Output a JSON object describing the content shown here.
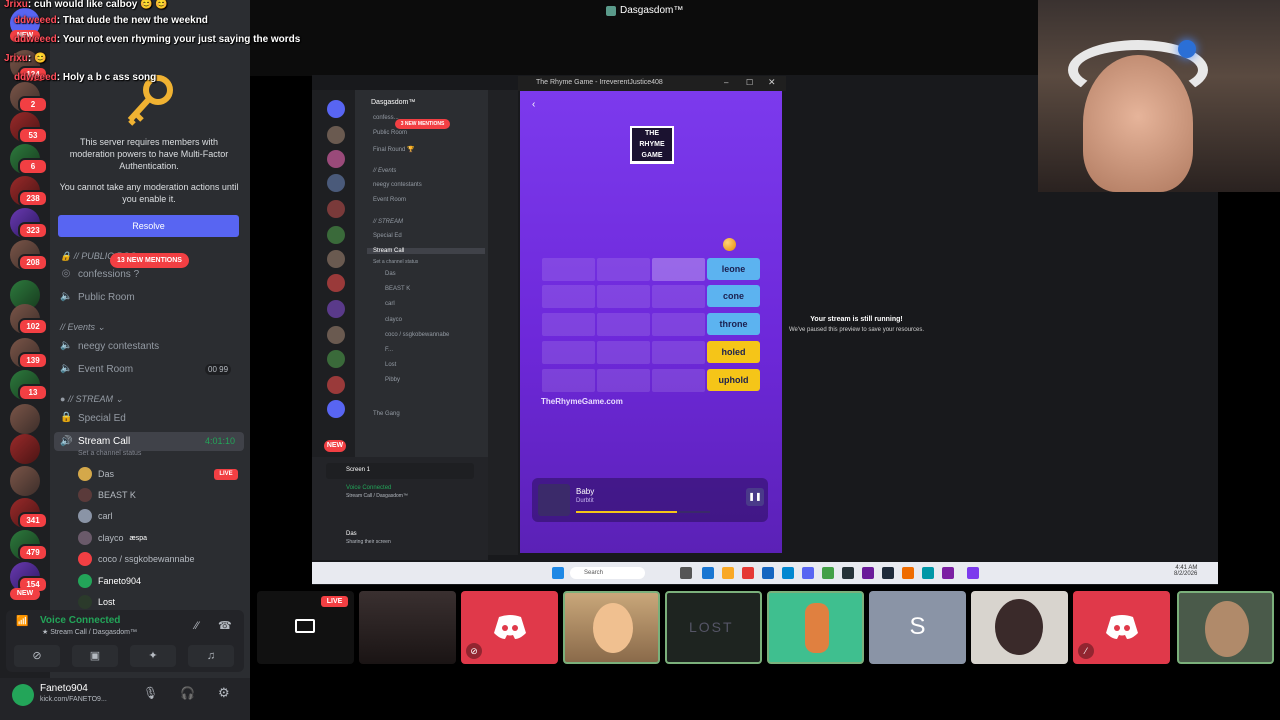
{
  "window": {
    "title": "Dasgasdom™"
  },
  "chat": [
    {
      "user": "Jrixu",
      "text": ": cuh would like calboy 😊 😊"
    },
    {
      "user": "ddweeed",
      "text": ": That dude the new the weeknd"
    },
    {
      "user": "ddweeed",
      "text": ": Your not even rhyming your just saying the words"
    },
    {
      "user": "Jrixu",
      "text": ": 😊"
    },
    {
      "user": "ddweeed",
      "text": ": Holy a b c ass song"
    }
  ],
  "rail": {
    "new_label": "NEW",
    "badges": [
      "124",
      "2",
      "53",
      "6",
      "238",
      "323",
      "208",
      "102",
      "139",
      "13",
      "341",
      "479",
      "154"
    ],
    "bottom_new": "NEW"
  },
  "server": {
    "name": "Dasgasdom™",
    "mfa_text": "This server requires members with moderation powers to have Multi-Factor Authentication.",
    "mfa_subtext": "You cannot take any moderation actions until you enable it.",
    "resolve_label": "Resolve",
    "mentions": "13 NEW MENTIONS"
  },
  "channels": {
    "cat_public": "// PUBLIC ROO...",
    "confessions": "confessions ?",
    "public_room": "Public Room",
    "cat_events": "// Events",
    "neegy": "neegy contestants",
    "event_room": "Event Room",
    "event_count_a": "00",
    "event_count_b": "99",
    "cat_stream": "// STREAM",
    "special_ed": "Special Ed",
    "stream_call": "Stream Call",
    "stream_timer": "4:01:10",
    "channel_status": "Set a channel status"
  },
  "voice_users": [
    {
      "name": "Das",
      "live": "LIVE"
    },
    {
      "name": "BEAST K"
    },
    {
      "name": "carl"
    },
    {
      "name": "clayco",
      "tag": "æspa"
    },
    {
      "name": "coco / ssgkobewannabe"
    },
    {
      "name": "Faneto904"
    },
    {
      "name": "Lost"
    }
  ],
  "voice_panel": {
    "status": "Voice Connected",
    "location": "Stream Call / Dasgasdom™"
  },
  "me": {
    "name": "Faneto904",
    "status": "kick.com/FANETO9..."
  },
  "inner": {
    "server": "Dasgasdom™",
    "mentions": "3 NEW MENTIONS",
    "items": [
      "confess...",
      "Public Room",
      "Final Round 🏆",
      "// Events",
      "neegy contestants",
      "Event Room",
      "// STREAM",
      "Special Ed",
      "Stream Call",
      "Set a channel status",
      "Das",
      "BEAST K",
      "carl",
      "clayco",
      "coco / ssgkobewannabe",
      "F...",
      "Lost",
      "Pibby",
      "The Gang"
    ],
    "screen_label": "Screen 1",
    "voice": "Voice Connected",
    "voice_loc": "Stream Call / Dasgasdom™",
    "user": "Das",
    "user_status": "Sharing their screen",
    "new_label": "NEW"
  },
  "game_window": {
    "title": "The Rhyme Game - IrreverentJustice408"
  },
  "game": {
    "logo": [
      "THE",
      "RHYME",
      "GAME"
    ],
    "words": [
      {
        "text": "leone",
        "color": "blue"
      },
      {
        "text": "cone",
        "color": "blue"
      },
      {
        "text": "throne",
        "color": "blue"
      },
      {
        "text": "holed",
        "color": "yellow"
      },
      {
        "text": "uphold",
        "color": "yellow"
      }
    ],
    "site": "TheRhymeGame.com",
    "song": "Baby",
    "artist": "Durbtit",
    "progress": 0.75
  },
  "stream_notice": {
    "title": "Your stream is still running!",
    "body": "We've paused this preview to save your resources."
  },
  "taskbar": {
    "search": "Search",
    "time": "4:41 AM",
    "date": "8/2/2026"
  },
  "tiles": {
    "live": "LIVE"
  },
  "colors": {
    "blurple": "#5865f2",
    "red": "#f23f43",
    "green": "#23a559",
    "game_purple": "#7c3aed"
  }
}
